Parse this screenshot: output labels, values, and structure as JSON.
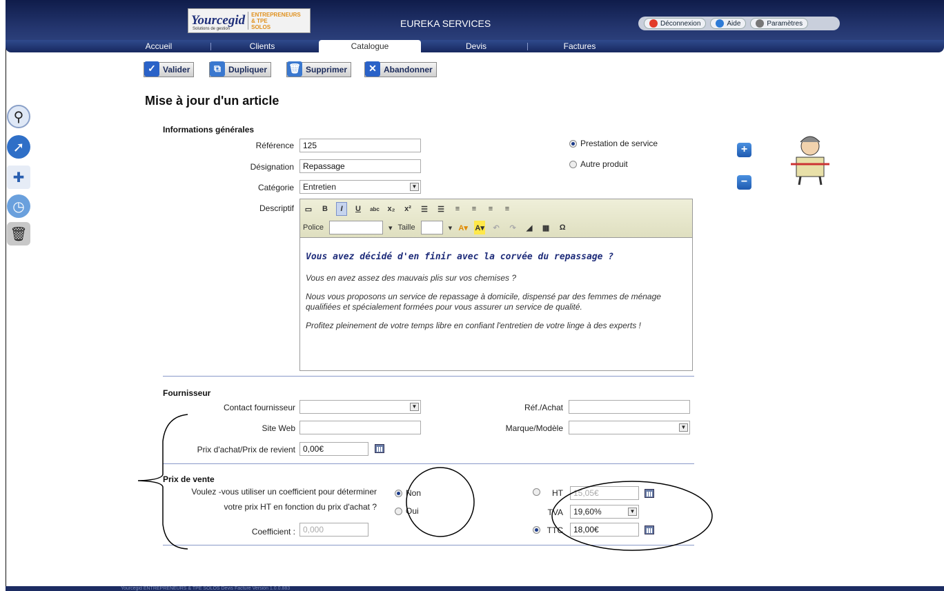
{
  "header": {
    "logo_main": "Yourcegid",
    "logo_line1": "ENTREPRENEURS",
    "logo_line2": "& TPE",
    "logo_line3": "SOLOS",
    "logo_tag": "Solutions de gestion",
    "title": "EUREKA SERVICES",
    "actions": [
      {
        "label": "Déconnexion",
        "color": "#e23b2a"
      },
      {
        "label": "Aide",
        "color": "#2e7bd6"
      },
      {
        "label": "Paramètres",
        "color": "#777777"
      }
    ]
  },
  "nav": [
    "Accueil",
    "Clients",
    "Catalogue",
    "Devis",
    "Factures"
  ],
  "toolbar": {
    "validate": "Valider",
    "duplicate": "Dupliquer",
    "delete": "Supprimer",
    "abandon": "Abandonner"
  },
  "page_title": "Mise à jour d'un article",
  "general": {
    "section": "Informations générales",
    "reference_label": "Référence",
    "reference_value": "125",
    "designation_label": "Désignation",
    "designation_value": "Repassage",
    "category_label": "Catégorie",
    "category_value": "Entretien",
    "description_label": "Descriptif",
    "type_service": "Prestation de service",
    "type_other": "Autre produit"
  },
  "editor": {
    "font_label": "Police",
    "size_label": "Taille",
    "heading": "Vous avez décidé d'en finir avec la corvée du repassage ?",
    "p1": "Vous en avez assez des mauvais plis sur vos chemises ?",
    "p2": "Nous vous proposons un service de repassage à domicile, dispensé par des femmes de ménage qualifiées et spécialement formées pour vous assurer un service de qualité.",
    "p3": "Profitez pleinement de votre temps libre en confiant l'entretien de votre linge à des experts !"
  },
  "supplier": {
    "section": "Fournisseur",
    "contact_label": "Contact fournisseur",
    "contact_value": "",
    "ref_label": "Réf./Achat",
    "ref_value": "",
    "web_label": "Site Web",
    "web_value": "",
    "brand_label": "Marque/Modèle",
    "brand_value": "",
    "cost_label": "Prix d'achat/Prix de revient",
    "cost_value": "0,00€"
  },
  "sale": {
    "section": "Prix de vente",
    "question_line1": "Voulez -vous utiliser un coefficient pour déterminer",
    "question_line2": "votre prix HT en fonction du prix d'achat ?",
    "no": "Non",
    "yes": "Oui",
    "coef_label": "Coefficient :",
    "coef_value": "0,000",
    "ht_label": "HT",
    "ht_value": "15,05€",
    "tva_label": "TVA",
    "tva_value": "19,60%",
    "ttc_label": "TTC",
    "ttc_value": "18,00€"
  },
  "footer": {
    "text": "Yourcegid ENTREPRENEURS & TPE SOLOS Devis Facture  Version 1.0.0.883"
  }
}
